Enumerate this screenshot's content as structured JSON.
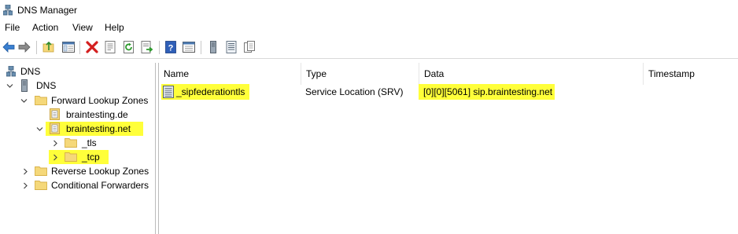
{
  "window": {
    "title": "DNS Manager",
    "app_icon": "dns-server-icon"
  },
  "menu": [
    "File",
    "Action",
    "View",
    "Help"
  ],
  "toolbar": [
    "back-icon",
    "forward-icon",
    "up-folder-icon",
    "show-hide-tree-icon",
    "delete-icon",
    "properties-icon",
    "refresh-icon",
    "export-icon",
    "help-icon",
    "console-icon",
    "server-icon",
    "list-icon",
    "copy-icon"
  ],
  "tree": {
    "root": "DNS",
    "server": "DNS",
    "forward": "Forward Lookup Zones",
    "zone1": "braintesting.de",
    "zone2": "braintesting.net",
    "tls": "_tls",
    "tcp": "_tcp",
    "reverse": "Reverse Lookup Zones",
    "conditional": "Conditional Forwarders"
  },
  "table": {
    "columns": [
      "Name",
      "Type",
      "Data",
      "Timestamp"
    ],
    "rows": [
      {
        "name": "_sipfederationtls",
        "type": "Service Location (SRV)",
        "data": "[0][0][5061] sip.braintesting.net",
        "timestamp": ""
      }
    ]
  },
  "colors": {
    "highlight": "#ffff3a",
    "folder": "#f5d87a",
    "folder_border": "#d8b24a"
  }
}
